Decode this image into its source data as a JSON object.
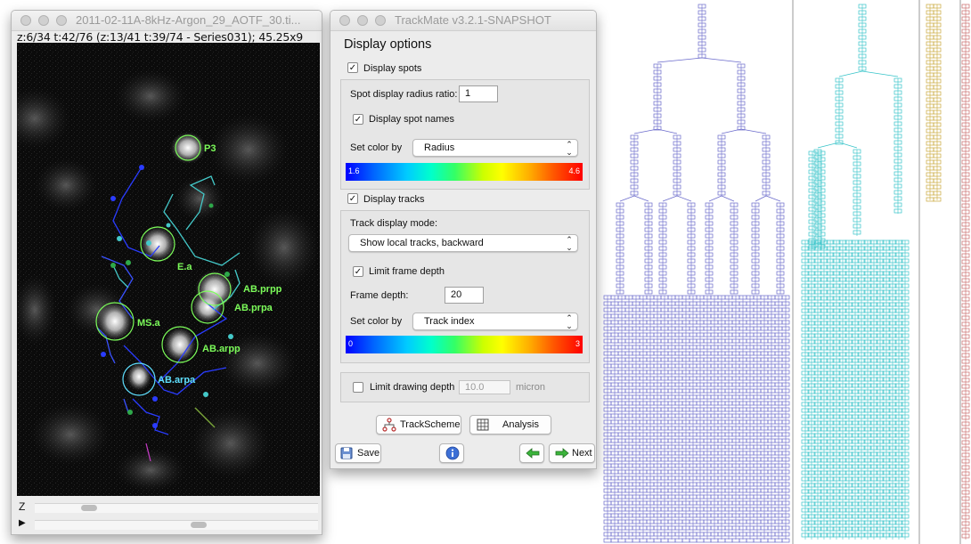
{
  "image_window": {
    "title": "2011-02-11A-8kHz-Argon_29_AOTF_30.ti...",
    "info": "z:6/34 t:42/76 (z:13/41  t:39/74 - Series031); 45.25x9",
    "z_label": "Z",
    "t_label": "▶",
    "spot_labels": [
      {
        "name": "P3",
        "color": "#7cfc5a"
      },
      {
        "name": "E.a",
        "color": "#7cfc5a"
      },
      {
        "name": "AB.prpp",
        "color": "#7cfc5a"
      },
      {
        "name": "AB.prpa",
        "color": "#7cfc5a"
      },
      {
        "name": "MS.a",
        "color": "#7cfc5a"
      },
      {
        "name": "AB.arpp",
        "color": "#7cfc5a"
      },
      {
        "name": "AB.arpa",
        "color": "#5fe0ff"
      }
    ]
  },
  "trackmate": {
    "title": "TrackMate v3.2.1-SNAPSHOT",
    "heading": "Display options",
    "display_spots": {
      "label": "Display spots",
      "checked": true
    },
    "spot_radius": {
      "label": "Spot display radius ratio:",
      "value": "1"
    },
    "display_spot_names": {
      "label": "Display spot names",
      "checked": true
    },
    "spot_color": {
      "label": "Set color by",
      "value": "Radius",
      "min": "1.6",
      "max": "4.6"
    },
    "display_tracks": {
      "label": "Display tracks",
      "checked": true
    },
    "track_mode": {
      "label": "Track display mode:",
      "value": "Show local tracks, backward"
    },
    "limit_frame_depth": {
      "label": "Limit frame depth",
      "checked": true
    },
    "frame_depth": {
      "label": "Frame depth:",
      "value": "20"
    },
    "track_color": {
      "label": "Set color by",
      "value": "Track index",
      "min": "0",
      "max": "3"
    },
    "limit_drawing_depth": {
      "label": "Limit drawing depth",
      "checked": false,
      "value": "10.0",
      "unit": "micron"
    },
    "buttons": {
      "trackscheme": "TrackScheme",
      "analysis": "Analysis",
      "save": "Save",
      "next": "Next"
    }
  },
  "lineage": {
    "colors": [
      "#6a6acb",
      "#37c4c9",
      "#c9a83a",
      "#c86a6a"
    ]
  },
  "icons": [
    "checkmark-icon",
    "chevron-updown-icon",
    "trackscheme-icon",
    "analysis-icon",
    "save-icon",
    "info-icon",
    "back-arrow-icon",
    "next-arrow-icon"
  ]
}
